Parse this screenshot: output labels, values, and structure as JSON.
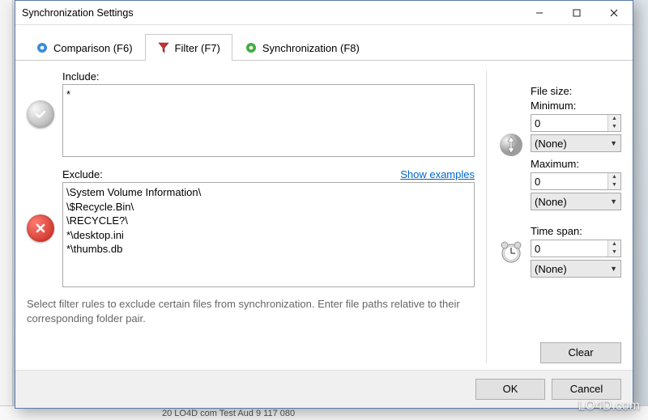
{
  "window": {
    "title": "Synchronization Settings"
  },
  "tabs": {
    "comparison": "Comparison (F6)",
    "filter": "Filter (F7)",
    "sync": "Synchronization (F8)"
  },
  "filter": {
    "include_label": "Include:",
    "include_value": "*",
    "exclude_label": "Exclude:",
    "exclude_value": "\\System Volume Information\\\n\\$Recycle.Bin\\\n\\RECYCLE?\\\n*\\desktop.ini\n*\\thumbs.db",
    "show_examples": "Show examples",
    "hint": "Select filter rules to exclude certain files from synchronization. Enter file paths relative to their corresponding folder pair."
  },
  "filesize": {
    "title": "File size:",
    "min_label": "Minimum:",
    "min_value": "0",
    "min_unit": "(None)",
    "max_label": "Maximum:",
    "max_value": "0",
    "max_unit": "(None)"
  },
  "timespan": {
    "title": "Time span:",
    "value": "0",
    "unit": "(None)"
  },
  "buttons": {
    "clear": "Clear",
    "ok": "OK",
    "cancel": "Cancel"
  },
  "backdrop": {
    "bottom_text": "20   LO4D com   Test Aud        9 117 080"
  },
  "watermark": "LO4D.com"
}
